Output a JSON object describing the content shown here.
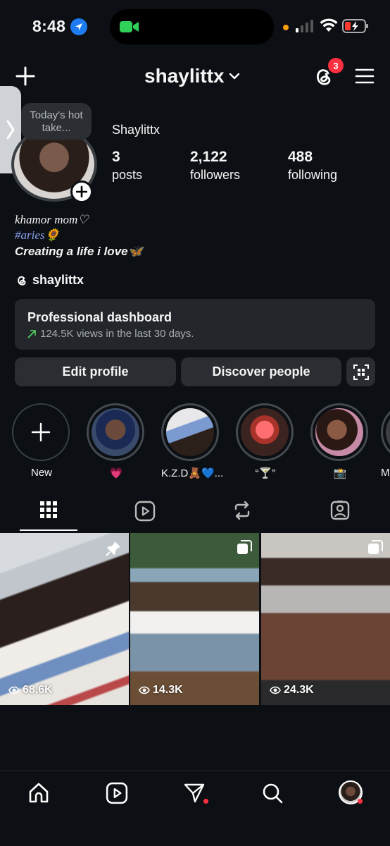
{
  "status": {
    "time": "8:48"
  },
  "header": {
    "username": "shaylittx",
    "threads_badge": "3"
  },
  "note": {
    "text": "Today's hot take..."
  },
  "profile": {
    "display_name": "Shaylittx",
    "stats": [
      {
        "value": "3",
        "label": "posts"
      },
      {
        "value": "2,122",
        "label": "followers"
      },
      {
        "value": "488",
        "label": "following"
      }
    ],
    "bio": [
      "khamor mom♡",
      "#aries🌻",
      "Creating a life i love🦋"
    ],
    "threads_handle": "shaylittx"
  },
  "dashboard": {
    "title": "Professional dashboard",
    "subtitle": "124.5K views in the last 30 days."
  },
  "buttons": {
    "edit": "Edit profile",
    "discover": "Discover people"
  },
  "highlights": [
    {
      "label": "New"
    },
    {
      "label": "💗"
    },
    {
      "label": "K.Z.D🧸💙..."
    },
    {
      "label": "“🍸”"
    },
    {
      "label": "📸"
    },
    {
      "label": "M"
    }
  ],
  "posts": [
    {
      "views": "68.6K"
    },
    {
      "views": "14.3K"
    },
    {
      "views": "24.3K"
    }
  ],
  "colors": {
    "background": "#0c1014",
    "badge": "#ff3040",
    "link": "#8ea3f4"
  }
}
